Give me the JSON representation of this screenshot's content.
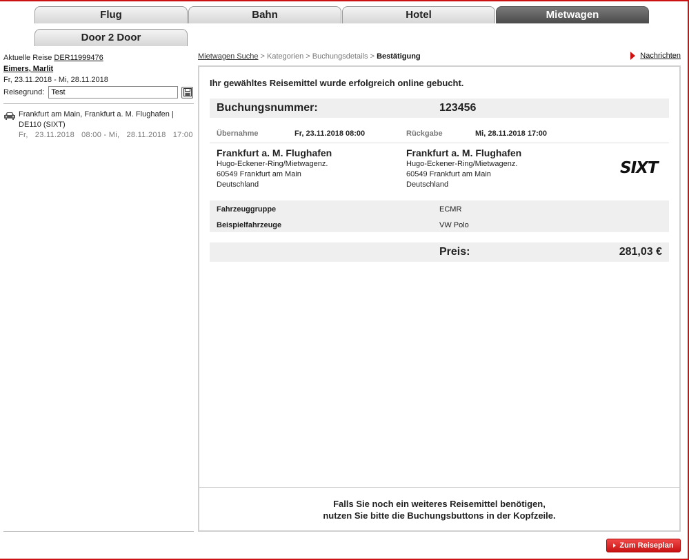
{
  "tabs": {
    "flug": "Flug",
    "bahn": "Bahn",
    "hotel": "Hotel",
    "mietwagen": "Mietwagen",
    "door2door": "Door 2 Door"
  },
  "sidebar": {
    "current_trip_label": "Aktuelle Reise",
    "current_trip_id": "DER11999476",
    "traveler": "Eimers, Marlit",
    "trip_dates": "Fr, 23.11.2018 - Mi, 28.11.2018",
    "reason_label": "Reisegrund:",
    "reason_value": "Test",
    "item_title": "Frankfurt am Main, Frankfurt a. M. Flughafen |",
    "item_code": "DE110 (SIXT)",
    "item_dates": "Fr,   23.11.2018   08:00 - Mi,   28.11.2018   17:00"
  },
  "breadcrumb": {
    "step1": "Mietwagen Suche",
    "sep": ">",
    "step2": "Kategorien",
    "step3": "Buchungsdetails",
    "step4": "Bestätigung"
  },
  "news": "Nachrichten",
  "main": {
    "success_msg": "Ihr gewähltes Reisemittel wurde erfolgreich online gebucht.",
    "booking_label": "Buchungsnummer:",
    "booking_number": "123456",
    "pickup_label": "Übernahme",
    "pickup_time": "Fr, 23.11.2018 08:00",
    "return_label": "Rückgabe",
    "return_time": "Mi, 28.11.2018 17:00",
    "pickup_loc": {
      "name": "Frankfurt a. M. Flughafen",
      "street": "Hugo-Eckener-Ring/Mietwagenz.",
      "city": "60549 Frankfurt am Main",
      "country": "Deutschland"
    },
    "return_loc": {
      "name": "Frankfurt a. M. Flughafen",
      "street": "Hugo-Eckener-Ring/Mietwagenz.",
      "city": "60549 Frankfurt am Main",
      "country": "Deutschland"
    },
    "logo": "SIXT",
    "vehicle_group_label": "Fahrzeuggruppe",
    "vehicle_group": "ECMR",
    "example_label": "Beispielfahrzeuge",
    "example_vehicle": "VW Polo",
    "price_label": "Preis:",
    "price_value": "281,03 €",
    "footer_line1": "Falls Sie noch ein weiteres Reisemittel benötigen,",
    "footer_line2": "nutzen Sie bitte die Buchungsbuttons in der Kopfzeile."
  },
  "buttons": {
    "to_itinerary": "Zum Reiseplan"
  },
  "colors": {
    "accent": "#cc1111",
    "active_tab": "#555555",
    "row_bg": "#efefef"
  }
}
